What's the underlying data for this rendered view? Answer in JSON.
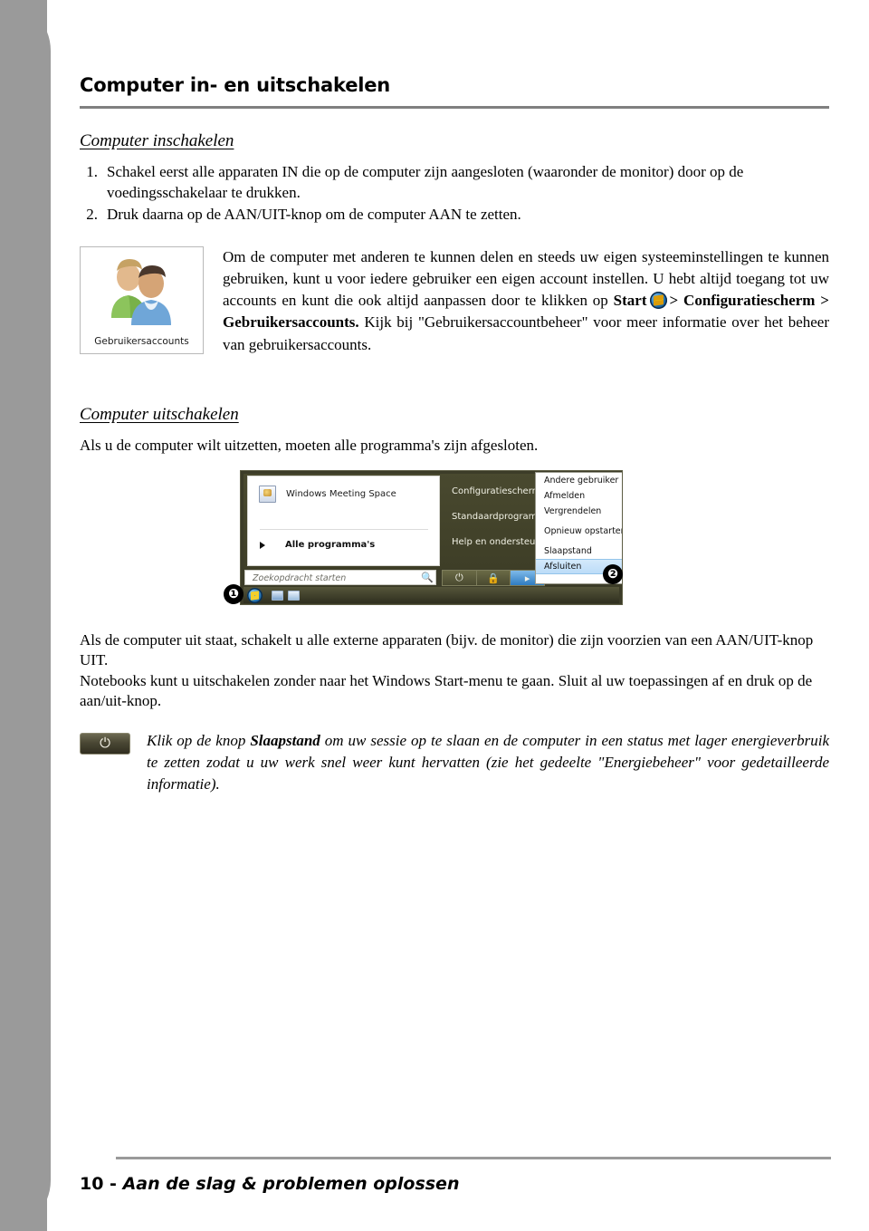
{
  "page": {
    "header_title": "Computer in- en uitschakelen",
    "footer_page_number": "10 - ",
    "footer_section": "Aan de slag & problemen oplossen"
  },
  "section_on": {
    "heading": "Computer inschakelen",
    "steps": [
      {
        "number": "1.",
        "text": "Schakel eerst alle apparaten IN die op de computer zijn aangesloten (waaronder de monitor) door op de voedingsschakelaar te drukken."
      },
      {
        "number": "2.",
        "text": "Druk daarna op de AAN/UIT-knop om de computer AAN te zetten."
      }
    ],
    "figure_caption": "Gebruikersaccounts",
    "paragraph_part1": "Om de computer met anderen te kunnen delen en steeds uw eigen systeeminstellingen te kunnen gebruiken, kunt u voor iedere gebruiker een eigen account instellen. U hebt altijd toegang tot uw accounts en kunt die ook altijd aanpassen door te klikken op ",
    "paragraph_bold_start": "Start",
    "paragraph_bold_path": "> Configuratiescherm > Gebruikersaccounts.",
    "paragraph_part2": " Kijk bij \"Gebruikersaccountbeheer\" voor meer informatie over het beheer van gebruikersaccounts."
  },
  "section_off": {
    "heading": "Computer uitschakelen",
    "intro": "Als u de computer wilt uitzetten, moeten alle programma's zijn afgesloten.",
    "after_paragraph_1": "Als de computer uit staat, schakelt u alle externe apparaten (bijv. de monitor) die zijn voorzien van een AAN/UIT-knop UIT.",
    "after_paragraph_2": "Notebooks kunt u uitschakelen zonder naar het Windows Start-menu te gaan. Sluit al uw toepassingen af en druk op de aan/uit-knop."
  },
  "start_menu": {
    "app_item": "Windows Meeting Space",
    "all_programs": "Alle programma's",
    "search_placeholder": "Zoekopdracht starten",
    "right_items": [
      "Configuratiescherm",
      "Standaardprogramma's",
      "Help en ondersteuning"
    ],
    "context_menu": [
      "Andere gebruiker",
      "Afmelden",
      "Vergrendelen",
      "Opnieuw opstarten",
      "Slaapstand",
      "Afsluiten"
    ],
    "context_menu_selected": "Afsluiten",
    "power_glyph": "⏻",
    "lock_glyph": "🔒",
    "arrow_glyph": "▸",
    "search_glyph": "🔍",
    "callout_1": "❶",
    "callout_2": "❷"
  },
  "note": {
    "lead_italic": "Klik op de knop ",
    "bold_word": "Slaapstand",
    "rest": " om uw sessie op te slaan en de computer in een status met lager energieverbruik te zetten zodat u uw werk snel weer kunt hervatten (zie het gedeelte \"Energiebeheer\" voor gedetailleerde informatie).",
    "power_glyph": "⏻"
  },
  "colors": {
    "band": "#9a9a9a",
    "rule": "#808080",
    "menu_olive": "#49492f",
    "selection_blue": "#bcdcf8"
  }
}
